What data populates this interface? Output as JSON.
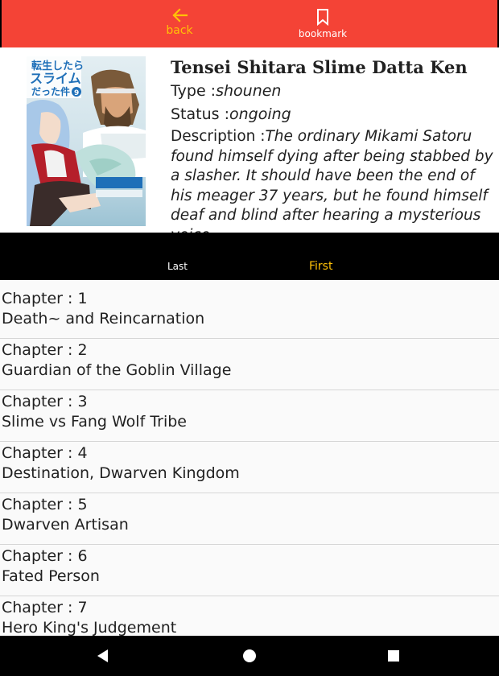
{
  "topbar": {
    "back_label": "back",
    "bookmark_label": "bookmark",
    "background_color": "#f44336",
    "back_color": "#ffc107",
    "bookmark_color": "#ffffff"
  },
  "manga": {
    "title": "Tensei Shitara Slime Datta Ken",
    "type_label": "Type :",
    "type_value": "shounen",
    "status_label": "Status :",
    "status_value": "ongoing",
    "description_label": "Description :",
    "description_value": "The ordinary Mikami Satoru found himself dying after being stabbed by a slasher. It should have been the end of his meager 37 years, but he found himself deaf and blind after hearing a mysterious voice.",
    "cover_title_jp_line1": "転生したら",
    "cover_title_jp_line2": "スライム",
    "cover_title_jp_line3": "だった件",
    "cover_volume": "9"
  },
  "tabs": {
    "last_label": "Last",
    "first_label": "First",
    "active": "First",
    "active_color": "#ffc107"
  },
  "chapters": [
    {
      "prefix": "Chapter : ",
      "number": "1",
      "name": "Death~ and Reincarnation"
    },
    {
      "prefix": "Chapter : ",
      "number": "2",
      "name": "Guardian of the Goblin Village"
    },
    {
      "prefix": "Chapter : ",
      "number": "3",
      "name": "Slime vs Fang Wolf Tribe"
    },
    {
      "prefix": "Chapter : ",
      "number": "4",
      "name": "Destination, Dwarven Kingdom"
    },
    {
      "prefix": "Chapter : ",
      "number": "5",
      "name": "Dwarven Artisan"
    },
    {
      "prefix": "Chapter : ",
      "number": "6",
      "name": "Fated Person"
    },
    {
      "prefix": "Chapter : ",
      "number": "7",
      "name": "Hero King's Judgement"
    }
  ],
  "navbar": {
    "back_icon": "triangle-back-icon",
    "home_icon": "circle-home-icon",
    "recent_icon": "square-recents-icon"
  }
}
